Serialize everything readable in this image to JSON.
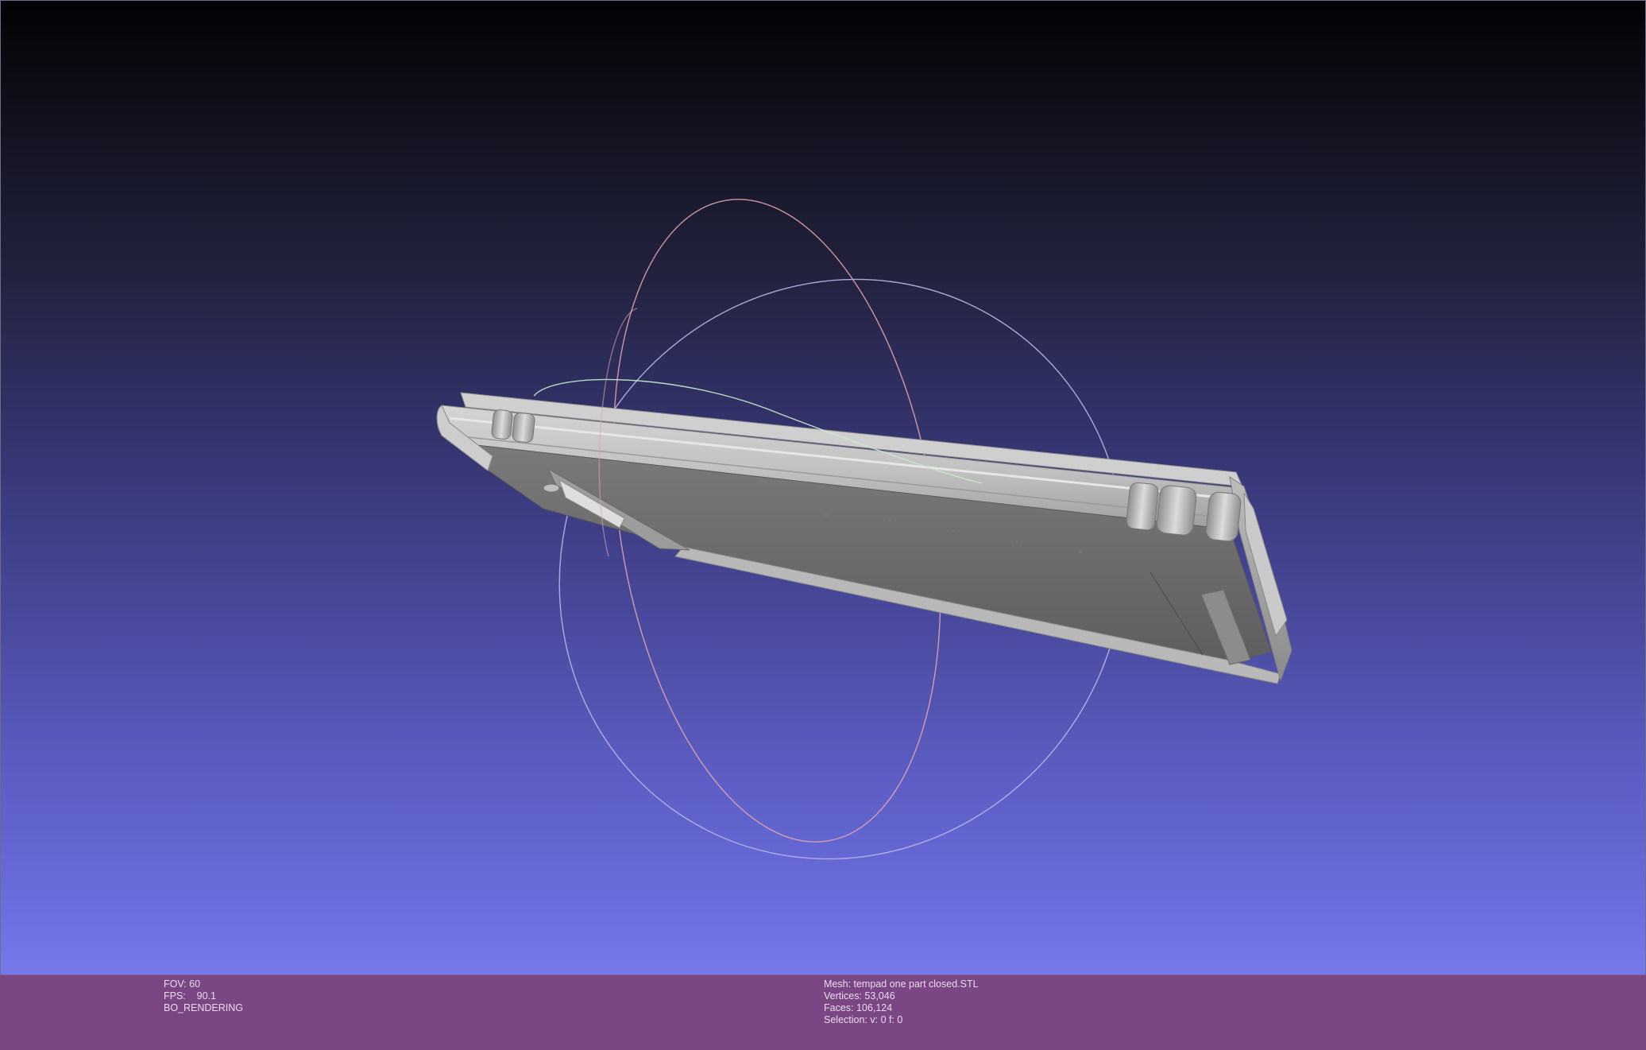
{
  "viewer": {
    "background_top": "#020204",
    "background_bottom": "#7a7ef0",
    "info_bar_color": "#7a4684",
    "mesh_color": "#a8a8a8",
    "trackball": {
      "ring_red": "#e6a0a8",
      "ring_green": "#c8f0c8",
      "ring_blue": "#b4b4e6"
    }
  },
  "info_left": {
    "fov": "FOV: 60",
    "fps": "FPS:    90.1",
    "mode": "BO_RENDERING"
  },
  "info_right": {
    "mesh": "Mesh: tempad one part closed.STL",
    "vertices": "Vertices: 53,046",
    "faces": "Faces: 106,124",
    "selection": "Selection: v: 0 f: 0"
  }
}
